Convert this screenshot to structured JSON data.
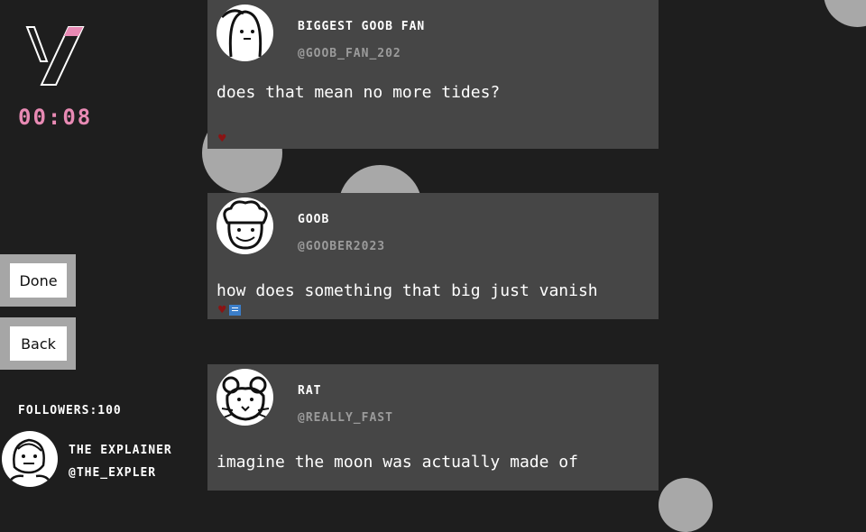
{
  "timer": "00:08",
  "buttons": {
    "done": "Done",
    "back": "Back"
  },
  "followers_label": "FOLLOWERS:100",
  "player": {
    "name": "THE EXPLAINER",
    "handle": "@THE_EXPLER"
  },
  "posts": [
    {
      "name": "BIGGEST GOOB FAN",
      "handle": "@GOOB_FAN_202",
      "text": "does that mean no more tides?",
      "icons": [
        "heart-icon"
      ]
    },
    {
      "name": "GOOB",
      "handle": "@GOOBER2023",
      "text": "how does something that big just vanish",
      "icons": [
        "heart-icon",
        "comment-icon"
      ]
    },
    {
      "name": "RAT",
      "handle": "@REALLY_FAST",
      "text": "imagine the moon was actually made of",
      "icons": []
    }
  ],
  "colors": {
    "background": "#1e1e1e",
    "post": "#464646",
    "timer": "#e88ab4",
    "heart": "#8a1414",
    "comment": "#3b7ec9",
    "handle": "#9b9b9b"
  }
}
